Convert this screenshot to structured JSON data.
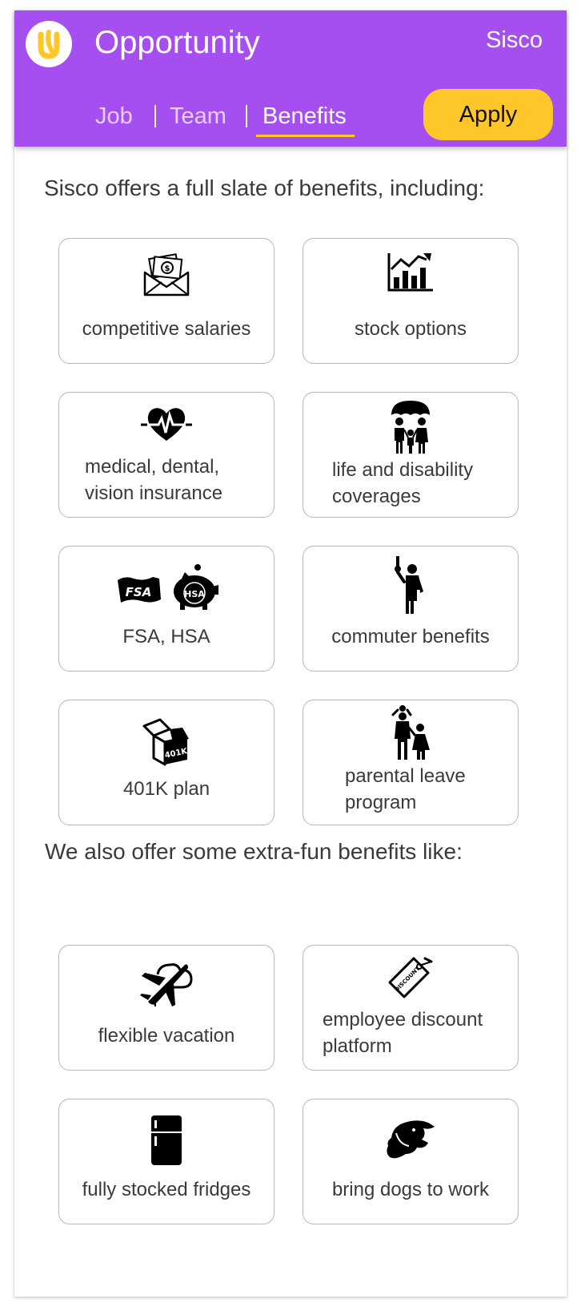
{
  "header": {
    "app_title": "Opportunity",
    "company": "Sisco",
    "logo_icon": "u-logo-icon",
    "tabs": [
      {
        "label": "Job"
      },
      {
        "label": "Team"
      },
      {
        "label": "Benefits"
      }
    ],
    "active_tab": "Benefits",
    "apply_label": "Apply",
    "colors": {
      "header_bg": "#a54ff0",
      "accent": "#ffc629"
    }
  },
  "main": {
    "heading": "Sisco offers a full slate of benefits, including:",
    "benefits": [
      {
        "icon": "money-envelope-icon",
        "label": "competitive salaries"
      },
      {
        "icon": "stock-chart-icon",
        "label": "stock options"
      },
      {
        "icon": "heartbeat-icon",
        "label": "medical, dental, vision insurance"
      },
      {
        "icon": "family-umbrella-icon",
        "label": "life and disability coverages"
      },
      {
        "icon": "fsa-hsa-icon",
        "label": "FSA, HSA",
        "badge_fsa": "FSA",
        "badge_hsa": "HSA"
      },
      {
        "icon": "commuter-icon",
        "label": "commuter benefits"
      },
      {
        "icon": "box-401k-icon",
        "label": "401K plan",
        "badge": "401K"
      },
      {
        "icon": "parent-child-icon",
        "label": "parental leave program"
      }
    ],
    "extras_heading": "We also offer some extra-fun benefits like:",
    "extras": [
      {
        "icon": "airplane-icon",
        "label": "flexible vacation"
      },
      {
        "icon": "discount-tag-icon",
        "label": "employee discount platform",
        "badge": "DISCOUNT"
      },
      {
        "icon": "fridge-icon",
        "label": "fully stocked fridges"
      },
      {
        "icon": "dog-icon",
        "label": "bring dogs to work"
      }
    ]
  }
}
